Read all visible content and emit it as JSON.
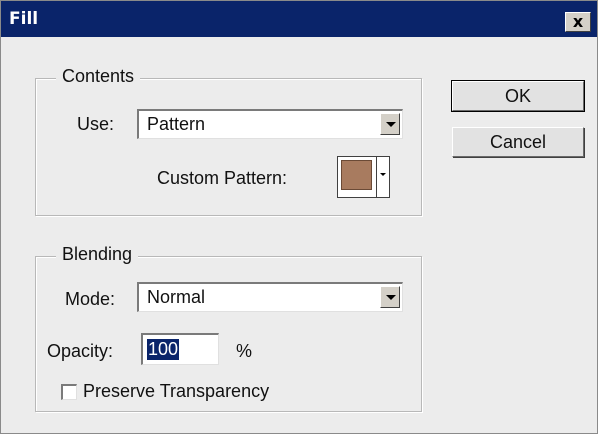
{
  "window": {
    "title": "Fill",
    "close_glyph": "x"
  },
  "contents": {
    "legend": "Contents",
    "use_label": "Use:",
    "use_value": "Pattern",
    "custom_pattern_label": "Custom Pattern:",
    "pattern_color": "#a87b5f"
  },
  "blending": {
    "legend": "Blending",
    "mode_label": "Mode:",
    "mode_value": "Normal",
    "opacity_label": "Opacity:",
    "opacity_value": "100",
    "opacity_unit": "%",
    "preserve_label": "Preserve Transparency",
    "preserve_checked": false
  },
  "buttons": {
    "ok_label": "OK",
    "cancel_label": "Cancel"
  }
}
